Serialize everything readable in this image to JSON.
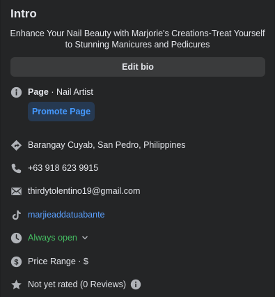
{
  "intro": {
    "title": "Intro",
    "bio": "Enhance Your Nail Beauty with Marjorie's Creations-Treat Yourself to Stunning Manicures and Pedicures",
    "edit_bio_label": "Edit bio"
  },
  "page_info": {
    "page_label": "Page",
    "separator": " · ",
    "category": "Nail Artist",
    "promote_label": "Promote Page"
  },
  "details": {
    "address": "Barangay Cuyab, San Pedro, Philippines",
    "phone": "+63 918 623 9915",
    "email": "thirdytolentino19@gmail.com",
    "tiktok": "marjieaddatuabante",
    "hours": "Always open",
    "price_range": "Price Range · $",
    "rating": "Not yet rated (0 Reviews)"
  },
  "colors": {
    "background": "#242526",
    "text": "#e4e6eb",
    "icon": "#b0b3b8",
    "link": "#5aa0ff",
    "open_green": "#45bd62",
    "button": "#3a3b3c",
    "promote_bg": "#263951",
    "promote_text": "#4599ff"
  },
  "icons": [
    "info-icon",
    "directions-icon",
    "phone-icon",
    "mail-icon",
    "tiktok-icon",
    "clock-icon",
    "dollar-icon",
    "star-icon",
    "info-icon"
  ]
}
